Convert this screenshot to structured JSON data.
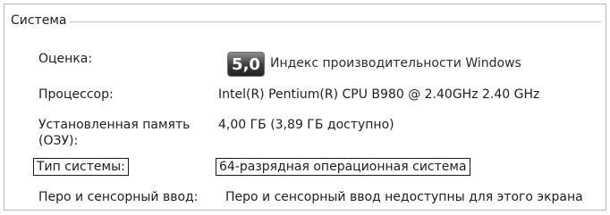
{
  "group": {
    "title": "Система"
  },
  "rows": {
    "rating": {
      "label": "Оценка:",
      "score": "5,0",
      "link": "Индекс производительности Windows"
    },
    "processor": {
      "label": "Процессор:",
      "value": "Intel(R) Pentium(R) CPU B980 @ 2.40GHz   2.40 GHz"
    },
    "memory": {
      "label": "Установленная память (ОЗУ):",
      "value": "4,00 ГБ (3,89 ГБ доступно)"
    },
    "system_type": {
      "label": "Тип системы:",
      "value": "64-разрядная операционная система"
    },
    "pen_touch": {
      "label": "Перо и сенсорный ввод:",
      "value": "Перо и сенсорный ввод недоступны для этого экрана"
    }
  }
}
